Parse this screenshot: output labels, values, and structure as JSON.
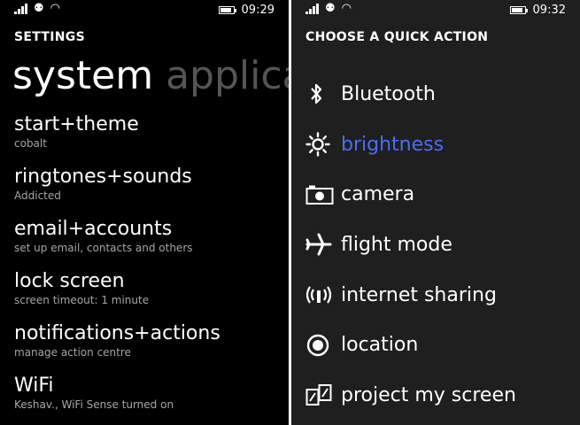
{
  "left": {
    "status": {
      "time": "09:29"
    },
    "section": "SETTINGS",
    "pivot": {
      "active": "system",
      "next": "applicat"
    },
    "items": [
      {
        "title": "start+theme",
        "subtitle": "cobalt"
      },
      {
        "title": "ringtones+sounds",
        "subtitle": "Addicted"
      },
      {
        "title": "email+accounts",
        "subtitle": "set up email, contacts and others"
      },
      {
        "title": "lock screen",
        "subtitle": "screen timeout: 1 minute"
      },
      {
        "title": "notifications+actions",
        "subtitle": "manage action centre"
      },
      {
        "title": "WiFi",
        "subtitle": "Keshav., WiFi Sense turned on"
      }
    ]
  },
  "right": {
    "status": {
      "time": "09:32"
    },
    "section": "CHOOSE A QUICK ACTION",
    "actions": [
      {
        "label": "Bluetooth",
        "icon": "bluetooth-icon"
      },
      {
        "label": "brightness",
        "icon": "brightness-icon",
        "selected": true
      },
      {
        "label": "camera",
        "icon": "camera-icon"
      },
      {
        "label": "flight mode",
        "icon": "airplane-icon"
      },
      {
        "label": "internet sharing",
        "icon": "internet-sharing-icon"
      },
      {
        "label": "location",
        "icon": "location-icon"
      },
      {
        "label": "project my screen",
        "icon": "project-screen-icon"
      }
    ]
  },
  "colors": {
    "accent": "#4a6ef5",
    "background_left": "#000000",
    "background_right": "#1f1f1f",
    "subtitle": "#a6a6a6"
  }
}
